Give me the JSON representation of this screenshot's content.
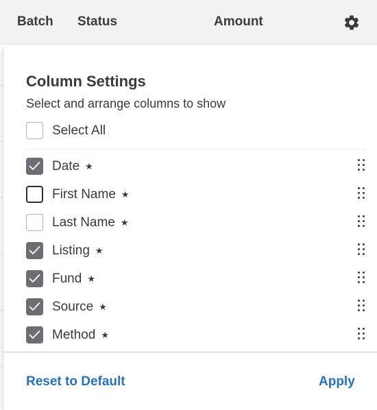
{
  "header": {
    "columns": {
      "batch": "Batch",
      "status": "Status",
      "amount": "Amount"
    },
    "settings_icon": "gear-icon"
  },
  "panel": {
    "title": "Column Settings",
    "subtitle": "Select and arrange columns to show",
    "select_all": {
      "label": "Select All",
      "checked": false
    },
    "columns": [
      {
        "label": "Date",
        "checked": true,
        "required_marker": "★"
      },
      {
        "label": "First Name",
        "checked": false,
        "required_marker": "★"
      },
      {
        "label": "Last Name",
        "checked": false,
        "required_marker": "★"
      },
      {
        "label": "Listing",
        "checked": true,
        "required_marker": "★"
      },
      {
        "label": "Fund",
        "checked": true,
        "required_marker": "★"
      },
      {
        "label": "Source",
        "checked": true,
        "required_marker": "★"
      },
      {
        "label": "Method",
        "checked": true,
        "required_marker": "★"
      }
    ],
    "reset_label": "Reset to Default",
    "apply_label": "Apply"
  },
  "colors": {
    "link": "#2a72b8",
    "checked_fill": "#6d6d73",
    "header_bg": "#f2f2f4"
  }
}
